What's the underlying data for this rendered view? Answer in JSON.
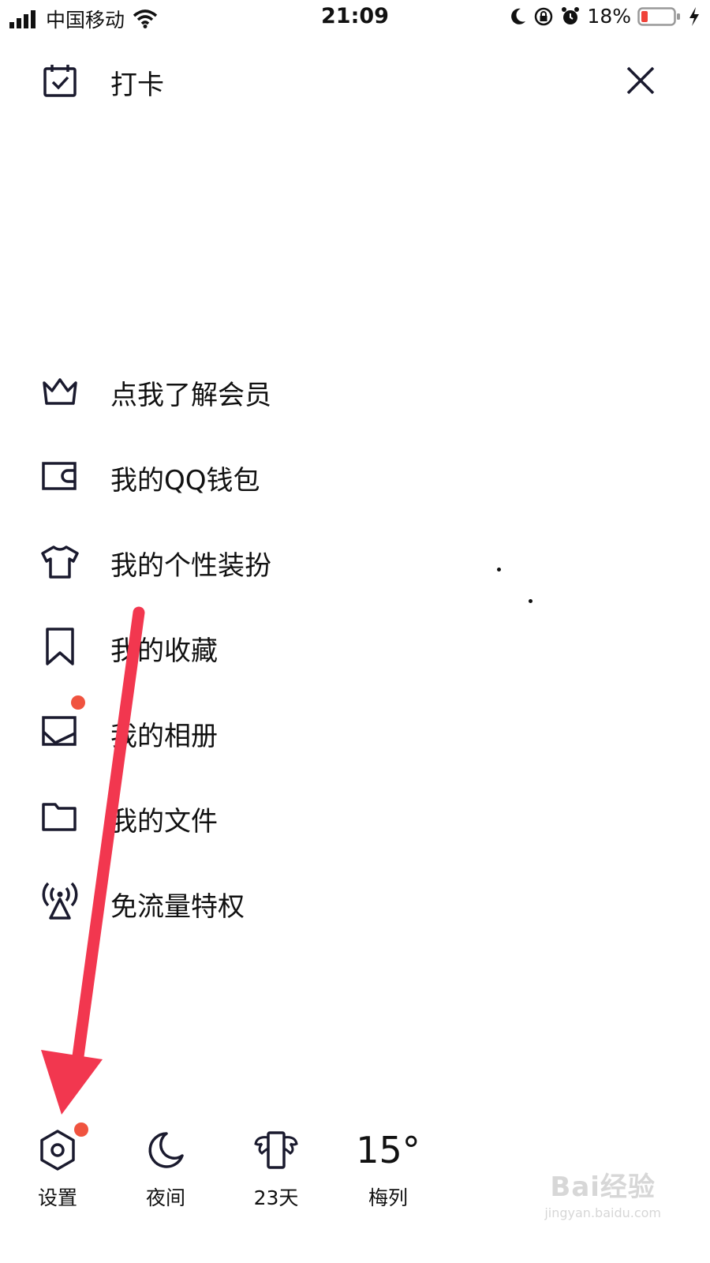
{
  "status_bar": {
    "carrier": "中国移动",
    "time": "21:09",
    "battery_percent": "18%"
  },
  "header": {
    "title": "打卡"
  },
  "menu": {
    "items": [
      {
        "label": "点我了解会员",
        "icon": "crown-icon"
      },
      {
        "label": "我的QQ钱包",
        "icon": "wallet-icon"
      },
      {
        "label": "我的个性装扮",
        "icon": "tshirt-icon"
      },
      {
        "label": "我的收藏",
        "icon": "bookmark-icon"
      },
      {
        "label": "我的相册",
        "icon": "photo-icon",
        "badge": true
      },
      {
        "label": "我的文件",
        "icon": "folder-icon"
      },
      {
        "label": "免流量特权",
        "icon": "antenna-icon"
      }
    ]
  },
  "bottom_bar": {
    "settings_label": "设置",
    "night_label": "夜间",
    "days_label": "23天",
    "weather_temp": "15°",
    "weather_city": "梅列"
  },
  "watermark": {
    "main": "Bai经验",
    "sub": "jingyan.baidu.com"
  },
  "colors": {
    "badge": "#f0533f",
    "arrow": "#f2374f",
    "icon_stroke": "#1a1a2e"
  }
}
